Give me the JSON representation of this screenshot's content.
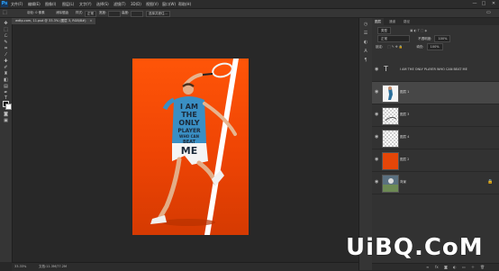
{
  "app": {
    "logo": "Ps",
    "title": "Photoshop"
  },
  "menu": [
    "文件(F)",
    "编辑(E)",
    "图像(I)",
    "图层(L)",
    "文字(Y)",
    "选择(S)",
    "滤镜(T)",
    "3D(D)",
    "视图(V)",
    "窗口(W)",
    "帮助(H)"
  ],
  "window_controls": {
    "minimize": "—",
    "restore": "□",
    "close": "✕"
  },
  "options": {
    "feather_label": "羽化: 0 像素",
    "antialias": "消除锯齿",
    "style_label": "样式:",
    "style_value": "正常",
    "width_label": "宽度:",
    "height_label": "高度:",
    "refine": "选择并遮住..."
  },
  "document_tab": {
    "title": "wdtp.com, 11.psd @ 33.3% (图层 3, RGB/8#)",
    "close": "×"
  },
  "status": {
    "zoom": "33.33%",
    "doc_info": "文档:11.3M/77.2M"
  },
  "artwork": {
    "colors": {
      "bg_top": "#ff5508",
      "bg_bottom": "#d53a02",
      "shirt": "#3a8fc4",
      "text": "#1c2a3a"
    },
    "shirt_text": [
      "I AM",
      "THE",
      "ONLY",
      "PLAYER",
      "WHO CAN",
      "BEAT",
      "ME"
    ]
  },
  "panel": {
    "tabs": [
      "图层",
      "通道",
      "路径"
    ],
    "kind_label": "类型",
    "blend_mode": "正常",
    "opacity_label": "不透明度:",
    "opacity_value": "100%",
    "lock_label": "锁定:",
    "fill_label": "填充:",
    "fill_value": "100%",
    "layers": [
      {
        "name": "I AM THE ONLY PLAYER WHO CAN BEAT ME",
        "kind": "text"
      },
      {
        "name": "图层 1",
        "kind": "photo-selected"
      },
      {
        "name": "图层 3",
        "kind": "transparent"
      },
      {
        "name": "图层 4",
        "kind": "transparent"
      },
      {
        "name": "图层 2",
        "kind": "orange"
      },
      {
        "name": "背景",
        "kind": "photo"
      }
    ],
    "bottom_icons": [
      "link-icon",
      "fx-icon",
      "mask-icon",
      "adjust-icon",
      "folder-icon",
      "new-layer-icon",
      "trash-icon"
    ]
  },
  "watermark": "UiBQ.CoM"
}
